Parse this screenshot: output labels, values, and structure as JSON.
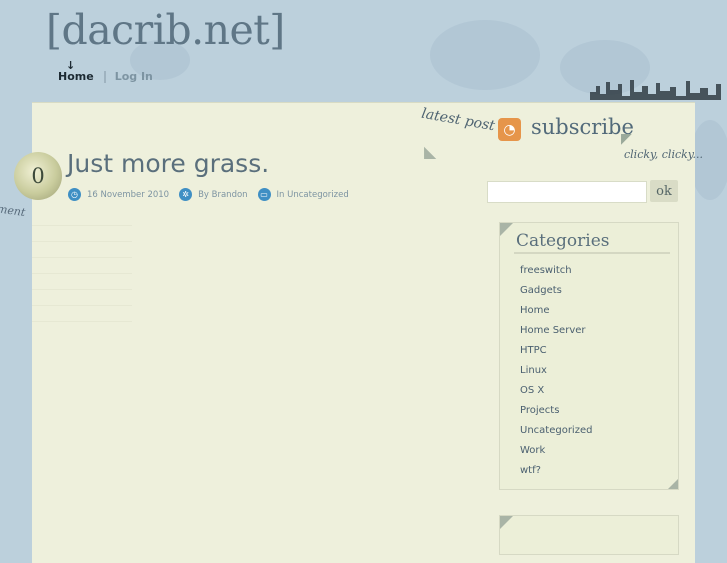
{
  "site": {
    "title": "[dacrib.net]"
  },
  "nav": {
    "home": "Home",
    "login": "Log In"
  },
  "header": {
    "latest_post": "latest post",
    "subscribe": "subscribe",
    "clicky": "clicky, clicky..."
  },
  "post": {
    "comment_count": "0",
    "comment_label": "omment",
    "title": "Just more grass.",
    "date": "16 November 2010",
    "author": "By Brandon",
    "category": "In Uncategorized"
  },
  "search": {
    "value": "",
    "button": "ok"
  },
  "categories": {
    "title": "Categories",
    "items": [
      "freeswitch",
      "Gadgets",
      "Home",
      "Home Server",
      "HTPC",
      "Linux",
      "OS X",
      "Projects",
      "Uncategorized",
      "Work",
      "wtf?"
    ]
  },
  "colors": {
    "accent": "#3f8fc4",
    "rss": "#e6954a",
    "paper": "#eef0dc"
  },
  "icons": {
    "clock": "clock-icon",
    "author": "gear-icon",
    "folder": "folder-icon",
    "rss": "rss-icon"
  }
}
